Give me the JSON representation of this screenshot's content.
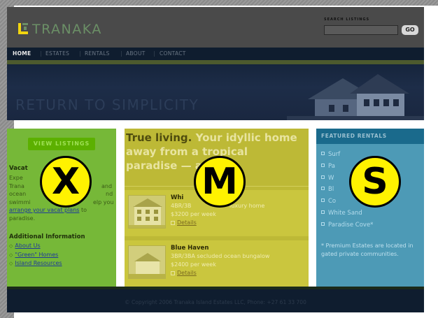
{
  "header": {
    "logo_text": "TRANAKA",
    "search_label": "SEARCH LISTINGS",
    "search_placeholder": "",
    "go_label": "GO"
  },
  "nav": {
    "items": [
      {
        "label": "HOME",
        "active": true
      },
      {
        "label": "ESTATES"
      },
      {
        "label": "RENTALS"
      },
      {
        "label": "ABOUT"
      },
      {
        "label": "CONTACT"
      }
    ]
  },
  "banner": {
    "tagline": "RETURN TO SIMPLICITY"
  },
  "left_column": {
    "button_label": "VIEW LISTINGS",
    "heading": "Vacat",
    "body_lines": [
      "Expe",
      "Trana",
      "ocean",
      "swimmi"
    ],
    "body_mid_fragment": "elp you",
    "body_link": "arrange your vacat plans",
    "body_after_link": " to",
    "body_end": "paradise.",
    "heading2": "Additional Information",
    "links": [
      "About Us",
      "\"Green\" Homes",
      "Island Resources"
    ],
    "frag_right_1": "and",
    "frag_right_2": "nd"
  },
  "middle_column": {
    "headline_part1": "True living. ",
    "headline_part2": "Your idyllic home",
    "headline_line2": "away from a tropical",
    "headline_line3": "paradise — arrival.",
    "listings": [
      {
        "title": "Whi",
        "desc_prefix": "4BR/3B",
        "desc_suffix": "luxury home",
        "price": "$3200 per week",
        "details": "Details"
      },
      {
        "title": "Blue Haven",
        "desc": "3BR/3BA secluded ocean bungalow",
        "price": "$2400 per week",
        "details": "Details"
      }
    ]
  },
  "right_column": {
    "title": "FEATURED RENTALS",
    "items": [
      "Surf",
      "Pa",
      "W",
      "Bl",
      "Co",
      "White Sand",
      "Paradise Cove*"
    ],
    "note": "* Premium Estates are located in gated private communities."
  },
  "badges": {
    "x": "X",
    "m": "M",
    "s": "S"
  },
  "footer": {
    "copyright": "© Copyright 2006 Tranaka Island Estates LLC, Phone: +27 61 33 700"
  },
  "colors": {
    "x_overlay": "#76b838",
    "m_overlay": "#bdb936",
    "s_overlay": "#4d9ab6",
    "badge_fill": "#fff200"
  }
}
